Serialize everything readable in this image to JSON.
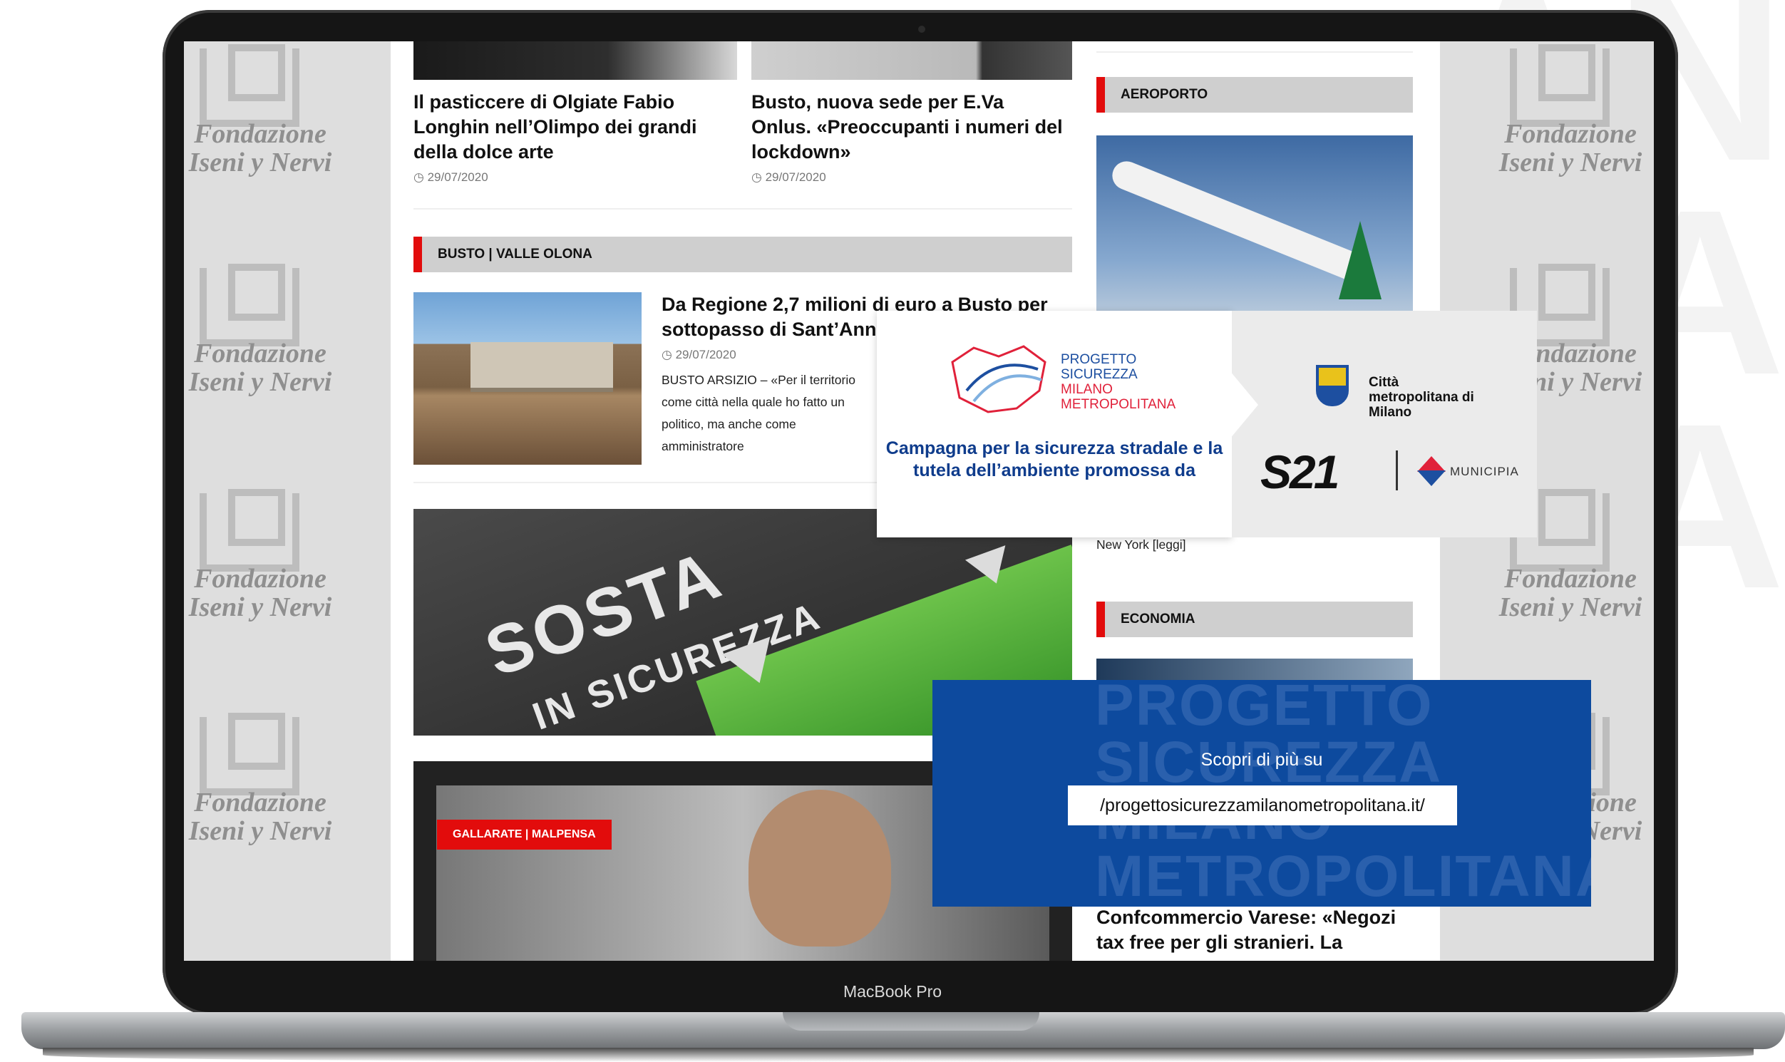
{
  "device": {
    "label": "MacBook Pro"
  },
  "watermark": {
    "line1": "Fondazione",
    "line2": "Iseni y Nervi"
  },
  "top_articles": [
    {
      "title": "Il pasticcere di Olgiate Fabio Longhin nell’Olimpo dei grandi della dolce arte",
      "date": "29/07/2020"
    },
    {
      "title": "Busto, nuova sede per E.Va Onlus. «Preoccupanti i numeri del lockdown»",
      "date": "29/07/2020"
    }
  ],
  "sections": {
    "busto": "BUSTO | VALLE OLONA",
    "aeroporto": "AEROPORTO",
    "economia": "ECONOMIA"
  },
  "feature_article": {
    "title": "Da Regione 2,7 milioni di euro a Busto per sottopasso di Sant’Anna",
    "date": "29/07/2020",
    "excerpt": "BUSTO ARSIZIO – «Per il territorio come città nella quale ho fatto un politico, ma anche come amministratore"
  },
  "banner": {
    "line1": "SOSTA",
    "line2": "IN SICUREZZA"
  },
  "gallarate_badge": "GALLARATE | MALPENSA",
  "aeroporto_snippet": "New York [leggi]",
  "economia_article": {
    "title": "Confcommercio Varese: «Negozi tax free per gli stranieri. La"
  },
  "ad": {
    "logo_lines": [
      "PROGETTO",
      "SICUREZZA",
      "MILANO",
      "METROPOLITANA"
    ],
    "campaign_text": "Campagna per la sicurezza stradale e la tutela dell’ambiente promossa da",
    "partner_1": "Città metropolitana di Milano",
    "partner_2_logo": "S21",
    "partner_3": "MUNICIPIA",
    "scopri_label": "Scopri di più su",
    "url": "/progettosicurezzamilanometropolitana.it/",
    "ghost_lines": [
      "PROGETTO",
      "SICUREZZA",
      "MILANO",
      "METROPOLITANA"
    ]
  },
  "colors": {
    "accent_red": "#e20c0c",
    "ad_blue": "#0d4a9e",
    "campaign_blue": "#0f3c8c"
  }
}
